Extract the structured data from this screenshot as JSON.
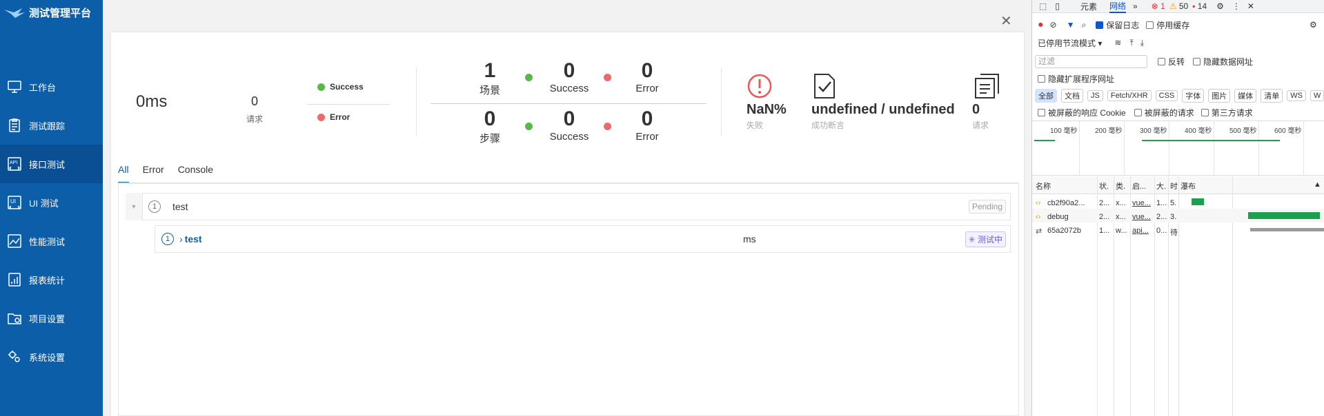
{
  "sidebar": {
    "title": "测试管理平台",
    "items": [
      {
        "label": "工作台",
        "icon": "monitor-icon"
      },
      {
        "label": "测试跟踪",
        "icon": "clipboard-icon"
      },
      {
        "label": "接口测试",
        "icon": "api-icon"
      },
      {
        "label": "UI 测试",
        "icon": "ui-icon"
      },
      {
        "label": "性能测试",
        "icon": "chart-icon"
      },
      {
        "label": "报表统计",
        "icon": "report-icon"
      },
      {
        "label": "项目设置",
        "icon": "folder-icon"
      },
      {
        "label": "系统设置",
        "icon": "gears-icon"
      }
    ],
    "active_index": 2
  },
  "summary": {
    "duration": "0ms",
    "requests_value": "0",
    "requests_label": "请求",
    "legend_success": "Success",
    "legend_error": "Error",
    "scenario": {
      "count": "1",
      "label": "场景",
      "success": "0",
      "success_label": "Success",
      "error": "0",
      "error_label": "Error"
    },
    "step": {
      "count": "0",
      "label": "步骤",
      "success": "0",
      "success_label": "Success",
      "error": "0",
      "error_label": "Error"
    },
    "fail_rate": "NaN%",
    "fail_label": "失败",
    "assertions": "undefined / undefined",
    "assertions_label": "成功断言",
    "req_count": "0",
    "req_label": "请求"
  },
  "tabs": [
    "All",
    "Error",
    "Console"
  ],
  "tree": {
    "row1": {
      "index": "1",
      "name": "test",
      "status": "Pending"
    },
    "row2": {
      "index": "1",
      "name": "test",
      "time": "ms",
      "status": "测试中"
    }
  },
  "devtools": {
    "tabs": [
      "元素",
      "网络"
    ],
    "errors": "1",
    "warnings": "50",
    "issues": "14",
    "preserve_log": "保留日志",
    "disable_cache": "停用缓存",
    "throttle": "已停用节流模式",
    "filter_placeholder": "过滤",
    "invert": "反转",
    "hide_data_urls": "隐藏数据网址",
    "hide_ext": "隐藏扩展程序网址",
    "types": [
      "全部",
      "文档",
      "JS",
      "Fetch/XHR",
      "CSS",
      "字体",
      "图片",
      "媒体",
      "清单",
      "WS",
      "W"
    ],
    "blocked_cookies": "被屏蔽的响应 Cookie",
    "blocked_req": "被屏蔽的请求",
    "third_party": "第三方请求",
    "ticks": [
      "100 毫秒",
      "200 毫秒",
      "300 毫秒",
      "400 毫秒",
      "500 毫秒",
      "600 毫秒"
    ],
    "columns": [
      "名称",
      "状.",
      "类.",
      "启...",
      "大.",
      "时",
      "瀑布"
    ],
    "rows": [
      {
        "name": "cb2f90a2...",
        "status": "2...",
        "type": "x...",
        "initiator": "vue...",
        "size": "1...",
        "time": "5."
      },
      {
        "name": "debug",
        "status": "2...",
        "type": "x...",
        "initiator": "vue...",
        "size": "2...",
        "time": "3."
      },
      {
        "name": "65a2072b",
        "status": "1...",
        "type": "w...",
        "initiator": "api...",
        "size": "0...",
        "time": "待"
      }
    ]
  }
}
